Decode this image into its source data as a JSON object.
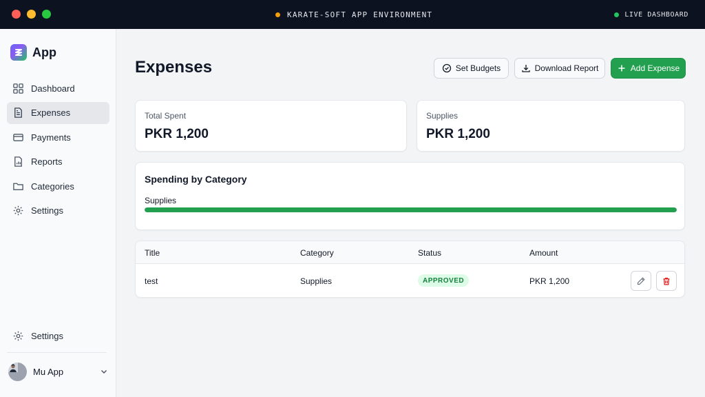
{
  "window": {
    "environment_label": "KARATE-SOFT APP ENVIRONMENT",
    "live_label": "LIVE DASHBOARD"
  },
  "sidebar": {
    "brand": "App",
    "items": [
      {
        "label": "Dashboard",
        "icon": "dashboard-grid-icon",
        "active": false
      },
      {
        "label": "Expenses",
        "icon": "document-icon",
        "active": true
      },
      {
        "label": "Payments",
        "icon": "credit-card-icon",
        "active": false
      },
      {
        "label": "Reports",
        "icon": "report-chart-icon",
        "active": false
      },
      {
        "label": "Categories",
        "icon": "folder-icon",
        "active": false
      },
      {
        "label": "Settings",
        "icon": "gear-icon",
        "active": false
      }
    ],
    "bottom_settings_label": "Settings",
    "user_name": "Mu App"
  },
  "header": {
    "title": "Expenses",
    "set_budgets_label": "Set Budgets",
    "download_report_label": "Download Report",
    "add_expense_label": "Add Expense"
  },
  "stats": [
    {
      "label": "Total Spent",
      "value": "PKR 1,200"
    },
    {
      "label": "Supplies",
      "value": "PKR 1,200"
    }
  ],
  "spending": {
    "title": "Spending by Category",
    "categories": [
      {
        "name": "Supplies",
        "fraction": 1.0
      }
    ]
  },
  "table": {
    "columns": [
      "Title",
      "Category",
      "Status",
      "Amount"
    ],
    "rows": [
      {
        "title": "test",
        "category": "Supplies",
        "status": "APPROVED",
        "amount": "PKR 1,200"
      }
    ]
  },
  "colors": {
    "accent_green": "#22a04f",
    "titlebar": "#0c1220",
    "status_approved_bg": "#dcfce7",
    "status_approved_text": "#15803d"
  }
}
